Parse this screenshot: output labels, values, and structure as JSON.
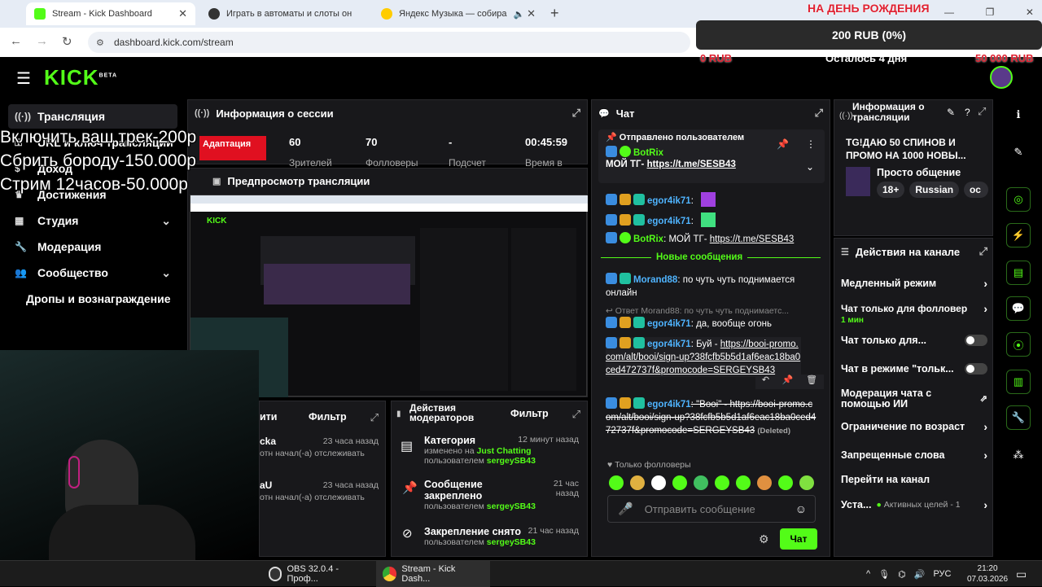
{
  "browser": {
    "tabs": [
      {
        "label": "Stream - Kick Dashboard",
        "icon": "kick-icon",
        "active": true
      },
      {
        "label": "Играть в автоматы и слоты он",
        "icon": "casino-icon",
        "active": false
      },
      {
        "label": "Яндекс Музыка — собира",
        "icon": "yandex-music-icon",
        "active": false
      }
    ],
    "url": "dashboard.kick.com/stream"
  },
  "donation_goal": {
    "title": "НА ДЕНЬ РОЖДЕНИЯ",
    "current": "200 RUB (0%)",
    "min": "0 RUB",
    "remaining": "Осталось 4 дня",
    "max": "50 000 RUB",
    "progress": 0
  },
  "overlay_lines": [
    "Включить ваш трек-200р",
    "Сбрить бороду-150.000р",
    "Стрим 12часов-50.000р"
  ],
  "sidebar": {
    "items": [
      {
        "label": "Трансляция",
        "icon": "broadcast-icon",
        "chevron": false
      },
      {
        "label": "URL и ключ трансляции",
        "icon": "key-icon",
        "chevron": false
      },
      {
        "label": "Доход",
        "icon": "money-icon",
        "chevron": false
      },
      {
        "label": "Достижения",
        "icon": "trophy-icon",
        "chevron": false
      },
      {
        "label": "Студия",
        "icon": "studio-icon",
        "chevron": true
      },
      {
        "label": "Модерация",
        "icon": "wrench-icon",
        "chevron": false
      },
      {
        "label": "Сообщество",
        "icon": "community-icon",
        "chevron": true
      },
      {
        "label": "Дропы и вознаграждение",
        "icon": "",
        "chevron": false
      }
    ]
  },
  "session": {
    "title": "Информация о сессии",
    "live_badge": "Адаптация",
    "stats": [
      {
        "value": "60",
        "label": "Зрителей"
      },
      {
        "value": "70",
        "label": "Фолловеры"
      },
      {
        "value": "-",
        "label": "Подсчет"
      },
      {
        "value": "00:45:59",
        "label": "Время в"
      }
    ]
  },
  "preview": {
    "title": "Предпросмотр трансляции"
  },
  "activity": {
    "title": "ити",
    "filter": "Фильтр",
    "rows": [
      {
        "name": "cka",
        "time": "23 часа назад",
        "text": "отн начал(-а) отслеживать"
      },
      {
        "name": "aU",
        "time": "23 часа назад",
        "text": "отн начал(-а) отслеживать"
      }
    ]
  },
  "mod_actions": {
    "title": "Действия модераторов",
    "filter": "Фильтр",
    "rows": [
      {
        "title": "Категория",
        "icon": "category-icon",
        "time": "12 минут назад",
        "line1": "изменено на",
        "highlight": "Just Chatting",
        "line2": "пользователем",
        "user": "sergeySB43"
      },
      {
        "title": "Сообщение закреплено",
        "icon": "pin-icon",
        "time": "21 час назад",
        "line2": "пользователем",
        "user": "sergeySB43"
      },
      {
        "title": "Закрепление снято",
        "icon": "unpin-icon",
        "time": "21 час назад",
        "line2": "пользователем",
        "user": "sergeySB43"
      }
    ]
  },
  "chat": {
    "title": "Чат",
    "pinned_header": "Отправлено пользователем",
    "pinned_user": "BotRix",
    "pinned_text": "МОЙ ТГ- ",
    "pinned_link": "https://t.me/SESB43",
    "messages": [
      {
        "user": "egor4ik71",
        "sep": ":"
      },
      {
        "user": "egor4ik71",
        "sep": ":"
      },
      {
        "user": "BotRix",
        "sep": ":",
        "text": " МОЙ ТГ- ",
        "link": "https://t.me/SESB43"
      }
    ],
    "new_messages": "Новые сообщения",
    "msg_morand": {
      "user": "Morand88",
      "text": ": по чуть чуть поднимается онлайн"
    },
    "reply_to": "Ответ Morand88: по чуть чуть поднимаетс...",
    "msg_reply": {
      "user": "egor4ik71",
      "text": ": да, вообще огонь"
    },
    "msg_link": {
      "user": "egor4ik71",
      "text": ": Буй - ",
      "link": "https://booi-promo.com/alt/booi/sign-up?38fcfb5b5d1af6eac18ba0ced472737f&promocode=SERGEYSB43"
    },
    "msg_deleted": {
      "user": "egor4ik71",
      "text": ": \"Booi\" - ",
      "link": "https://booi-promo.com/alt/booi/sign-up?38fcfb5b5d1af6eac18ba0ced472737f&promocode=SERGEYSB43",
      "tag": "(Deleted)"
    },
    "followers_only": "Только фолловеры",
    "input_placeholder": "Отправить сообщение",
    "send_label": "Чат"
  },
  "stream_info": {
    "title": "Информация о трансляции",
    "stream_title": "TG!ДАЮ 50 СПИНОВ И ПРОМО НА 1000 НОВЫ...",
    "category": "Просто общение",
    "tags": [
      "18+",
      "Russian",
      "ос"
    ]
  },
  "channel_actions": {
    "title": "Действия на канале",
    "rows": [
      {
        "label": "Медленный режим",
        "control": "chevron"
      },
      {
        "label": "Чат только для фолловер",
        "sub": "1 мин",
        "control": "chevron"
      },
      {
        "label": "Чат только для...",
        "control": "toggle"
      },
      {
        "label": "Чат в режиме \"тольк...",
        "control": "toggle"
      },
      {
        "label": "Модерация чата с помощью ИИ",
        "control": "external"
      },
      {
        "label": "Ограничение по возраст",
        "control": "chevron"
      },
      {
        "label": "Запрещенные слова",
        "control": "chevron"
      },
      {
        "label": "Перейти на канал",
        "control": "none"
      },
      {
        "label": "Уста...",
        "sub": "Активных целей - 1",
        "control": "chevron"
      }
    ]
  },
  "taskbar": {
    "apps": [
      {
        "label": "OBS 32.0.4 - Проф...",
        "icon": "obs-icon"
      },
      {
        "label": "Stream - Kick Dash...",
        "icon": "chrome-icon"
      }
    ],
    "lang": "РУС",
    "time": "21:20",
    "date": "07.03.2026"
  },
  "colors": {
    "accent": "#53fc18",
    "panel": "#18181b",
    "live": "#e01020"
  }
}
